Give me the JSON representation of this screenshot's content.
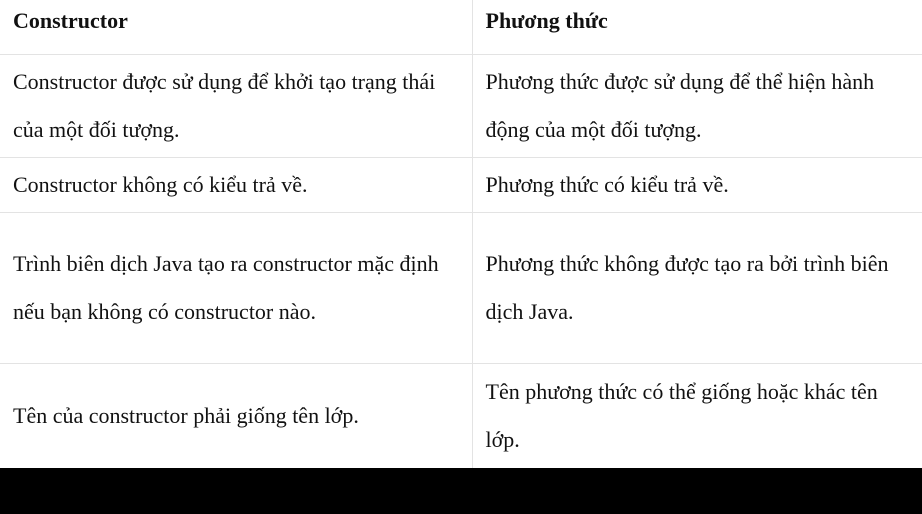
{
  "table": {
    "headers": [
      "Constructor",
      "Phương thức"
    ],
    "rows": [
      [
        "Constructor được sử dụng để khởi tạo trạng thái của một đối tượng.",
        "Phương thức được sử dụng để thể hiện hành động của một đối tượng."
      ],
      [
        "Constructor không có kiểu trả về.",
        "Phương thức có kiểu trả về."
      ],
      [
        "Trình biên dịch Java tạo ra constructor mặc định nếu bạn không có constructor nào.",
        "Phương thức không được tạo ra bởi trình biên dịch Java."
      ],
      [
        "Tên của constructor phải giống tên lớp.",
        "Tên phương thức có thể giống hoặc khác tên lớp."
      ]
    ]
  }
}
